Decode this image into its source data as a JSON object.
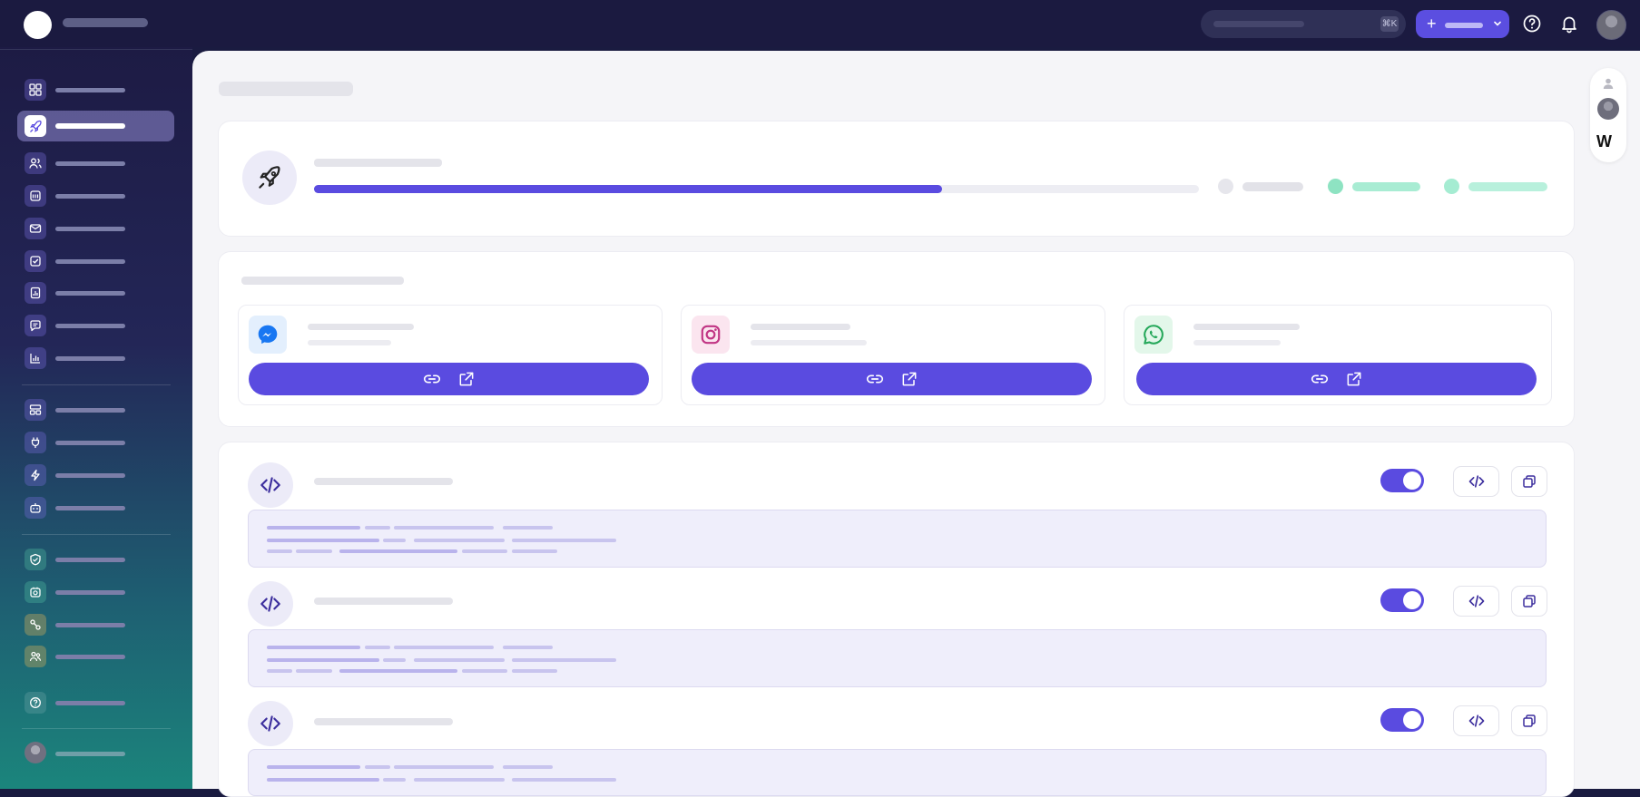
{
  "topbar": {
    "search": {
      "placeholder": "",
      "shortcut": "⌘K"
    },
    "create_button": {
      "icon": "plus-icon"
    },
    "icons": [
      "help-icon",
      "bell-icon"
    ]
  },
  "sidebar": {
    "groups": [
      [
        "grid-icon",
        "rocket-icon",
        "users-icon",
        "calendar-icon",
        "mail-icon",
        "checkbox-icon",
        "report-icon",
        "chat-icon",
        "bar-chart-icon"
      ],
      [
        "layout-icon",
        "plug-icon",
        "lightning-icon",
        "robot-icon"
      ],
      [
        "shield-icon",
        "camera-icon",
        "workflow-icon",
        "team-icon"
      ],
      [
        "help-circle-icon"
      ]
    ],
    "active": "rocket-icon"
  },
  "progress": {
    "value": 0.71
  },
  "channels": [
    {
      "name": "messenger",
      "icon": "messenger-icon",
      "color": "#1877f2"
    },
    {
      "name": "instagram",
      "icon": "instagram-icon",
      "color": "#c13584"
    },
    {
      "name": "whatsapp",
      "icon": "whatsapp-icon",
      "color": "#25d366"
    }
  ],
  "embeds": [
    {
      "enabled": true
    },
    {
      "enabled": true
    },
    {
      "enabled": true
    }
  ],
  "colors": {
    "accent": "#5a4be0",
    "success": "#8ee3c2",
    "topbar": "#1b1a40"
  }
}
